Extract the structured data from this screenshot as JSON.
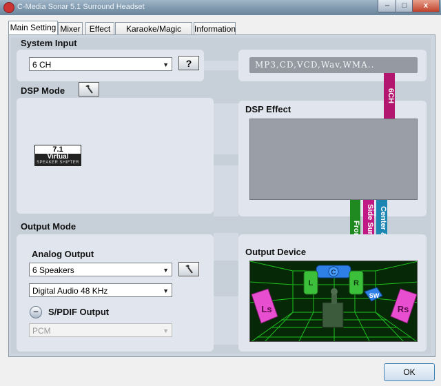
{
  "window": {
    "title": "C-Media Sonar 5.1 Surround Headset",
    "min": "–",
    "max": "□",
    "close": "x"
  },
  "tabs": [
    {
      "label": "Main Setting"
    },
    {
      "label": "Mixer"
    },
    {
      "label": "Effect"
    },
    {
      "label": "Karaoke/Magic Voice"
    },
    {
      "label": "Information"
    }
  ],
  "system_input": {
    "label": "System Input",
    "selected": "6 CH",
    "help_label": "?",
    "sources_text": "MP3,CD,VCD,Wav,WMA.."
  },
  "dsp_mode": {
    "label": "DSP Mode",
    "logo": {
      "top": "7.1",
      "mid": "Virtual",
      "bottom": "SPEAKER SHIFTER"
    }
  },
  "dsp_effect": {
    "label": "DSP Effect"
  },
  "channels": {
    "six_ch": "6CH",
    "front": "Front",
    "side_surround": "Side Surround",
    "center_sub": "Center & Sub"
  },
  "output_mode": {
    "label": "Output Mode",
    "analog_label": "Analog Output",
    "speakers_selected": "6 Speakers",
    "digital_selected": "Digital Audio 48 KHz",
    "spdif_label": "S/PDIF Output",
    "spdif_selected": "PCM"
  },
  "output_device": {
    "label": "Output Device",
    "speakers": {
      "L": "L",
      "C": "C",
      "R": "R",
      "SW": "SW",
      "Ls": "Ls",
      "Rs": "Rs"
    }
  },
  "footer": {
    "ok_label": "OK"
  },
  "colors": {
    "six_ch": "#b3166f",
    "front": "#1f8a1f",
    "side_surround": "#c01884",
    "center_sub": "#1c86b2",
    "grid_green": "#1fc01f",
    "speaker_magenta": "#e84fd0",
    "speaker_green": "#3cc03c",
    "speaker_blue": "#2e80e6"
  }
}
